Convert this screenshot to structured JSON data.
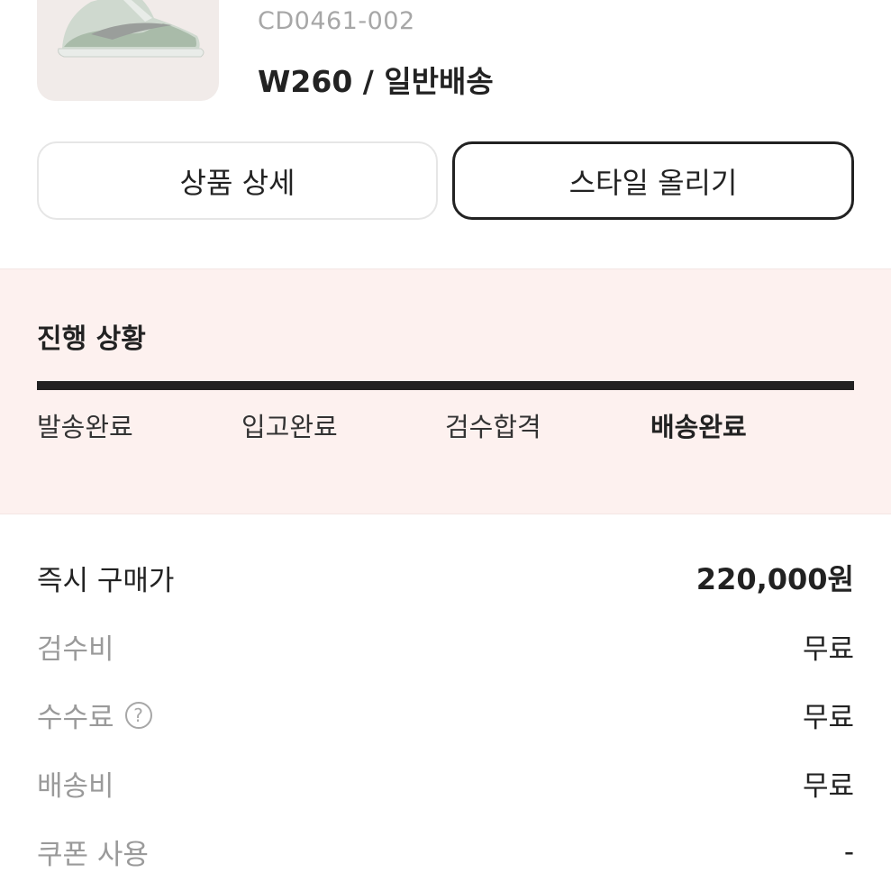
{
  "product": {
    "image_icon": "sneaker-image",
    "model_number": "CD0461-002",
    "size_shipping": "W260 / 일반배송"
  },
  "actions": {
    "detail_label": "상품 상세",
    "style_label": "스타일 올리기"
  },
  "progress": {
    "title": "진행 상황",
    "steps": [
      "발송완료",
      "입고완료",
      "검수합격",
      "배송완료"
    ],
    "active_step": "배송완료",
    "bar_color": "#222222"
  },
  "pricing": {
    "rows": [
      {
        "label": "즉시 구매가",
        "value": "220,000원"
      },
      {
        "label": "검수비",
        "value": "무료"
      },
      {
        "label": "수수료",
        "value": "무료",
        "help_icon": "?"
      },
      {
        "label": "배송비",
        "value": "무료"
      },
      {
        "label": "쿠폰 사용",
        "value": "-"
      }
    ]
  },
  "colors": {
    "panel_background": "#fdf1ef",
    "thumb_background": "#f1ebe9",
    "text_primary": "#222222",
    "text_muted": "#9a9a9a"
  }
}
